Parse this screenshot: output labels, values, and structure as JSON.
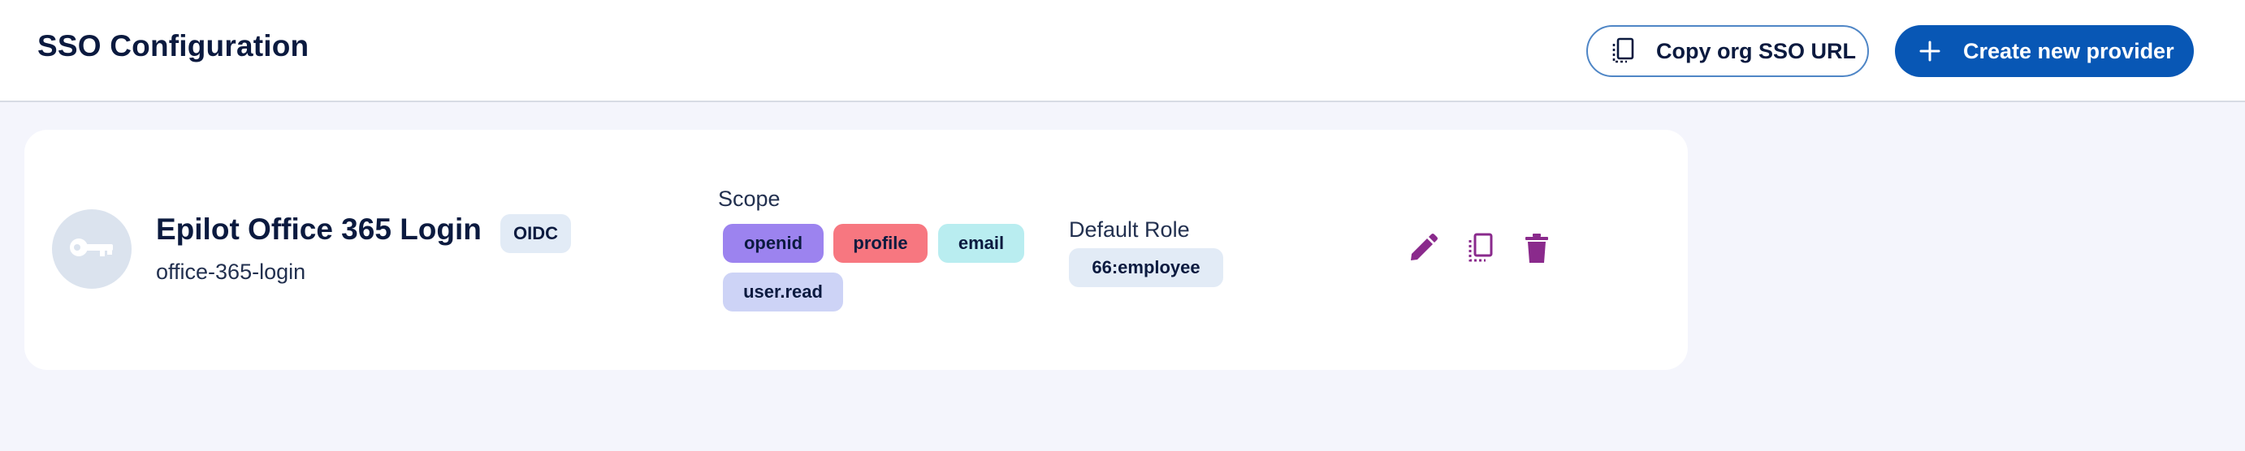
{
  "header": {
    "title": "SSO Configuration",
    "copy_button_label": "Copy org SSO URL",
    "copy_button_icon": "copy-icon",
    "create_button_label": "Create new provider",
    "create_button_icon": "plus-icon"
  },
  "provider": {
    "avatar_icon": "key-icon",
    "name": "Epilot Office 365 Login",
    "type": "OIDC",
    "slug": "office-365-login",
    "scope_label": "Scope",
    "scopes": [
      "openid",
      "profile",
      "email",
      "user.read"
    ],
    "default_role_label": "Default Role",
    "default_role": "66:employee",
    "actions": [
      "edit-icon",
      "copy-icon",
      "delete-icon"
    ]
  },
  "colors": {
    "primary": "#0857b5",
    "action_icon": "#8a2a8c",
    "background": "#f4f5fc"
  }
}
